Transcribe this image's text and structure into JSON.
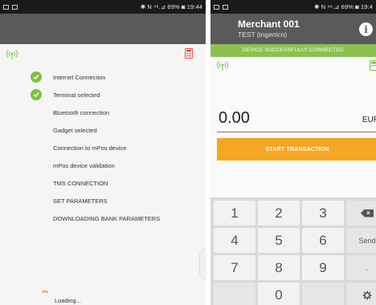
{
  "left": {
    "status_bar": {
      "right": "✱ N ⁴⁸.⊿ 69% ◙ 19:44"
    },
    "steps": [
      {
        "label": "Internet Connection",
        "done": true
      },
      {
        "label": "Terminal selected",
        "done": true
      },
      {
        "label": "Bluetooth connection",
        "done": false
      },
      {
        "label": "Gadget selected",
        "done": false
      },
      {
        "label": "Connection to mPos device",
        "done": false
      },
      {
        "label": "mPos device validation",
        "done": false
      },
      {
        "label": "TMS CONNECTION",
        "done": false
      },
      {
        "label": "SET PARAMETERS",
        "done": false
      },
      {
        "label": "DOWNLOADING BANK PARAMETERS",
        "done": false
      }
    ],
    "loading_text": "Loading..."
  },
  "right": {
    "status_bar": {
      "right": "✱ N ⁴⁸.⊿ 69% ◙ 19:4"
    },
    "merchant_name": "Merchant 001",
    "merchant_sub": "TEST (ingenico)",
    "info_icon": "i",
    "banner": "DEVICE SUCCESSFULLY CONNECTED",
    "amount": "0.00",
    "currency": "EUR",
    "start_button": "START TRANSACTION",
    "keys": {
      "k1": "1",
      "k2": "2",
      "k3": "3",
      "k4": "4",
      "k5": "5",
      "k6": "6",
      "send": "Send",
      "k7": "7",
      "k8": "8",
      "k9": "9",
      "dot": ".",
      "k0": "0"
    }
  },
  "colors": {
    "success_green": "#7dc242",
    "banner_green": "#8cc152",
    "accent_orange": "#f5a623",
    "alert_red": "#e84c4c",
    "appbar_gray": "#5a5a5a"
  },
  "icons": [
    "signal-icon",
    "calculator-icon",
    "check-icon",
    "info-icon",
    "backspace-icon",
    "settings-icon"
  ]
}
